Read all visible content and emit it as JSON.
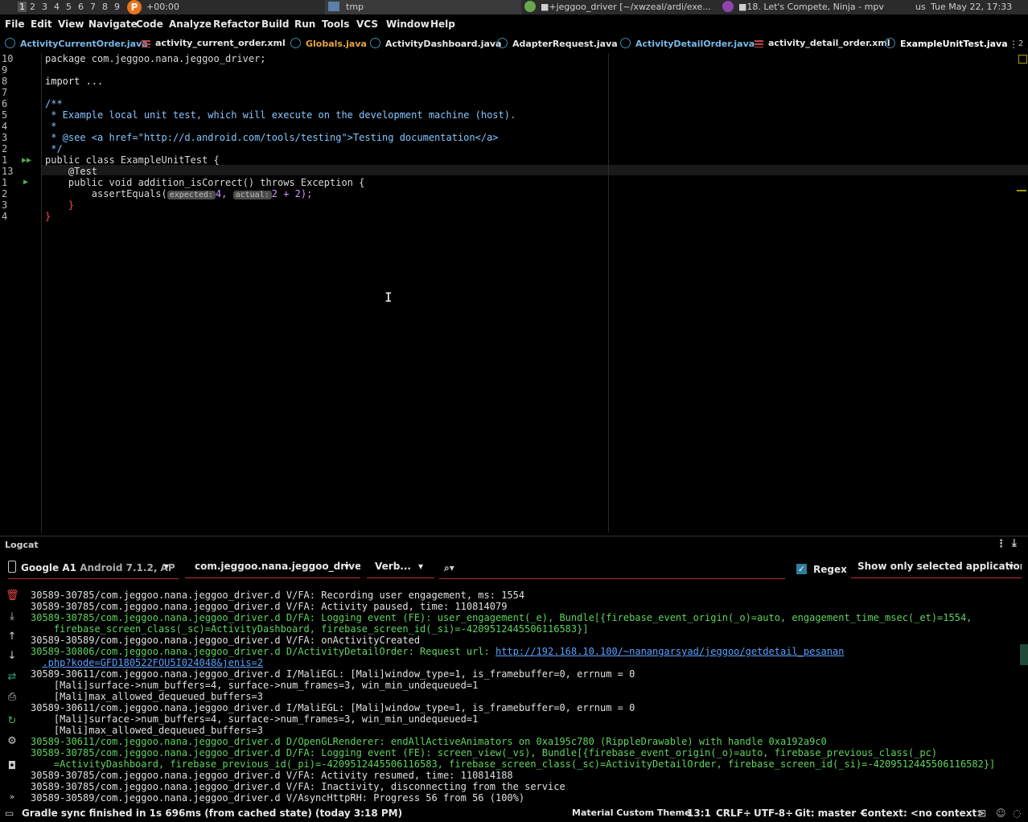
{
  "system_bar": {
    "workspaces": [
      "1",
      "2",
      "3",
      "4",
      "5",
      "6",
      "7",
      "8",
      "9"
    ],
    "active_workspace": "1",
    "clock_label": "+00:00",
    "tasks": [
      "tmp",
      "■+jeggoo_driver [~/xwzeal/ardi/exe...",
      "■18. Let's Compete, Ninja - mpv"
    ],
    "locale": "us",
    "datetime": "Tue May 22, 17:33"
  },
  "menu": [
    "File",
    "Edit",
    "View",
    "Navigate",
    "Code",
    "Analyze",
    "Refactor",
    "Build",
    "Run",
    "Tools",
    "VCS",
    "Window",
    "Help"
  ],
  "tabs": [
    {
      "label": "ActivityCurrentOrder.java",
      "type": "java",
      "color": "#7ab8e6"
    },
    {
      "label": "activity_current_order.xml",
      "type": "xml",
      "color": "#e6e6e6"
    },
    {
      "label": "Globals.java",
      "type": "java",
      "color": "#e8a33d"
    },
    {
      "label": "ActivityDashboard.java",
      "type": "java",
      "color": "#e6e6e6"
    },
    {
      "label": "AdapterRequest.java",
      "type": "java",
      "color": "#e6e6e6"
    },
    {
      "label": "ActivityDetailOrder.java",
      "type": "java",
      "color": "#7ab8e6"
    },
    {
      "label": "activity_detail_order.xml",
      "type": "xml",
      "color": "#e6e6e6"
    },
    {
      "label": "ExampleUnitTest.java",
      "type": "java",
      "color": "#ffffff",
      "active": true
    }
  ],
  "tab_overflow": "2",
  "editor": {
    "lines": [
      {
        "num": "10",
        "text": "package com.jeggoo.nana.jeggoo_driver;"
      },
      {
        "num": "9",
        "text": ""
      },
      {
        "num": "8",
        "text": "import ..."
      },
      {
        "num": "7",
        "text": ""
      },
      {
        "num": "6",
        "text": "/**"
      },
      {
        "num": "5",
        "text": " * Example local unit test, which will execute on the development machine (host)."
      },
      {
        "num": "4",
        "text": " *"
      },
      {
        "num": "3",
        "text": " * @see <a href=\"http://d.android.com/tools/testing\">Testing documentation</a>"
      },
      {
        "num": "2",
        "text": " */"
      },
      {
        "num": "1",
        "text": "public class ExampleUnitTest {"
      },
      {
        "num": "13",
        "text": "    @Test"
      },
      {
        "num": "1",
        "text": "    public void addition_isCorrect() throws Exception {"
      },
      {
        "num": "2",
        "text": "        assertEquals("
      },
      {
        "num": "3",
        "text": "    }"
      },
      {
        "num": "4",
        "text": "}"
      }
    ],
    "hint_expected": "expected:",
    "hint_actual": "actual:",
    "assert_args_1": "4,",
    "assert_args_2": "2 + 2);"
  },
  "logcat": {
    "title": "Logcat",
    "device": "Google A1",
    "device_detail": "Android 7.1.2, AP",
    "process": "com.jeggoo.nana.jeggoo_driver.",
    "level": "Verb...",
    "search_placeholder": "",
    "regex_label": "Regex",
    "regex_checked": true,
    "filter": "Show only selected application",
    "lines": [
      {
        "level": "V",
        "text": "30589-30785/com.jeggoo.nana.jeggoo_driver.d V/FA: Recording user engagement, ms: 1554"
      },
      {
        "level": "V",
        "text": "30589-30785/com.jeggoo.nana.jeggoo_driver.d V/FA: Activity paused, time: 110814079"
      },
      {
        "level": "D",
        "text": "30589-30785/com.jeggoo.nana.jeggoo_driver.d D/FA: Logging event (FE): user_engagement(_e), Bundle[{firebase_event_origin(_o)=auto, engagement_time_msec(_et)=1554,"
      },
      {
        "level": "D",
        "text": "    firebase_screen_class(_sc)=ActivityDashboard, firebase_screen_id(_si)=-4209512445506116583}]"
      },
      {
        "level": "V",
        "text": "30589-30589/com.jeggoo.nana.jeggoo_driver.d V/FA: onActivityCreated"
      },
      {
        "level": "D",
        "text": "30589-30806/com.jeggoo.nana.jeggoo_driver.d D/ActivityDetailOrder: Request url: "
      },
      {
        "level": "D",
        "text": "  "
      },
      {
        "level": "I",
        "text": "30589-30611/com.jeggoo.nana.jeggoo_driver.d I/MaliEGL: [Mali]window_type=1, is_framebuffer=0, errnum = 0"
      },
      {
        "level": "I",
        "text": "    [Mali]surface->num_buffers=4, surface->num_frames=3, win_min_undequeued=1"
      },
      {
        "level": "I",
        "text": "    [Mali]max_allowed_dequeued_buffers=3"
      },
      {
        "level": "I",
        "text": "30589-30611/com.jeggoo.nana.jeggoo_driver.d I/MaliEGL: [Mali]window_type=1, is_framebuffer=0, errnum = 0"
      },
      {
        "level": "I",
        "text": "    [Mali]surface->num_buffers=4, surface->num_frames=3, win_min_undequeued=1"
      },
      {
        "level": "I",
        "text": "    [Mali]max_allowed_dequeued_buffers=3"
      },
      {
        "level": "D",
        "text": "30589-30611/com.jeggoo.nana.jeggoo_driver.d D/OpenGLRenderer: endAllActiveAnimators on 0xa195c780 (RippleDrawable) with handle 0xa192a9c0"
      },
      {
        "level": "D",
        "text": "30589-30785/com.jeggoo.nana.jeggoo_driver.d D/FA: Logging event (FE): screen_view(_vs), Bundle[{firebase_event_origin(_o)=auto, firebase_previous_class(_pc)"
      },
      {
        "level": "D",
        "text": "    =ActivityDashboard, firebase_previous_id(_pi)=-4209512445506116583, firebase_screen_class(_sc)=ActivityDetailOrder, firebase_screen_id(_si)=-4209512445506116582}]"
      },
      {
        "level": "V",
        "text": "30589-30785/com.jeggoo.nana.jeggoo_driver.d V/FA: Activity resumed, time: 110814188"
      },
      {
        "level": "V",
        "text": "30589-30785/com.jeggoo.nana.jeggoo_driver.d V/FA: Inactivity, disconnecting from the service"
      },
      {
        "level": "V",
        "text": "30589-30589/com.jeggoo.nana.jeggoo_driver.d V/AsyncHttpRH: Progress 56 from 56 (100%)"
      }
    ],
    "url_part1": "http://192.168.10.100/~nanangarsyad/jeggoo/getdetail_pesanan",
    "url_part2": ".php?kode=GFD180522FOU5I024048&jenis=2"
  },
  "status": {
    "message": "Gradle sync finished in 1s 696ms (from cached state) (today 3:18 PM)",
    "theme": "Material Custom Theme",
    "position": "13:1",
    "line_sep": "CRLF÷",
    "encoding": "UTF-8÷",
    "git": "Git: master ÷",
    "context": "Context: <no context>"
  }
}
